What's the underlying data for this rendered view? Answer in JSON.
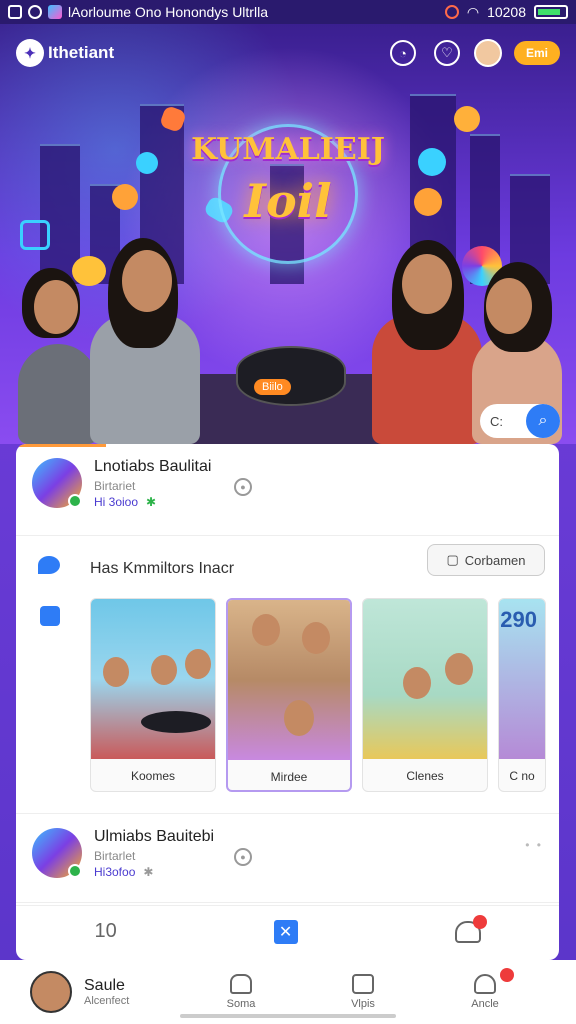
{
  "status_bar": {
    "title": "lAorloume Ono Honondys Ultrlla",
    "time": "10208"
  },
  "header": {
    "logo_text": "Ithetiant",
    "action_button": "Emi"
  },
  "hero": {
    "title": "KUMALIEIJ",
    "subtitle": "Ioil",
    "turntable_tag": "Biilo",
    "search_text": "C:"
  },
  "posts": [
    {
      "name": "Lnotiabs Baulitai",
      "handle": "Birtariet",
      "count": "Hi 3oioo"
    },
    {
      "name": "Ulmiabs Bauitebi",
      "handle": "Birtarlet",
      "count": "Hi3ofoo"
    }
  ],
  "section": {
    "title": "Has Kmmiltors Inacr",
    "button": "Corbamen",
    "thumbnails": [
      {
        "caption": "Koomes"
      },
      {
        "caption": "Mirdee"
      },
      {
        "caption": "Clenes"
      },
      {
        "caption": "C no",
        "badge": "290"
      }
    ]
  },
  "card_bottom": {
    "count": "10"
  },
  "nav": {
    "user_name": "Saule",
    "user_sub": "Alcenfect",
    "items": [
      {
        "label": "Soma"
      },
      {
        "label": "Vlpis"
      },
      {
        "label": "Ancle"
      }
    ]
  },
  "colors": {
    "accent": "#2e7cf6",
    "brand": "#6a3bd6",
    "highlight": "#ffb020",
    "online": "#2db34a"
  }
}
